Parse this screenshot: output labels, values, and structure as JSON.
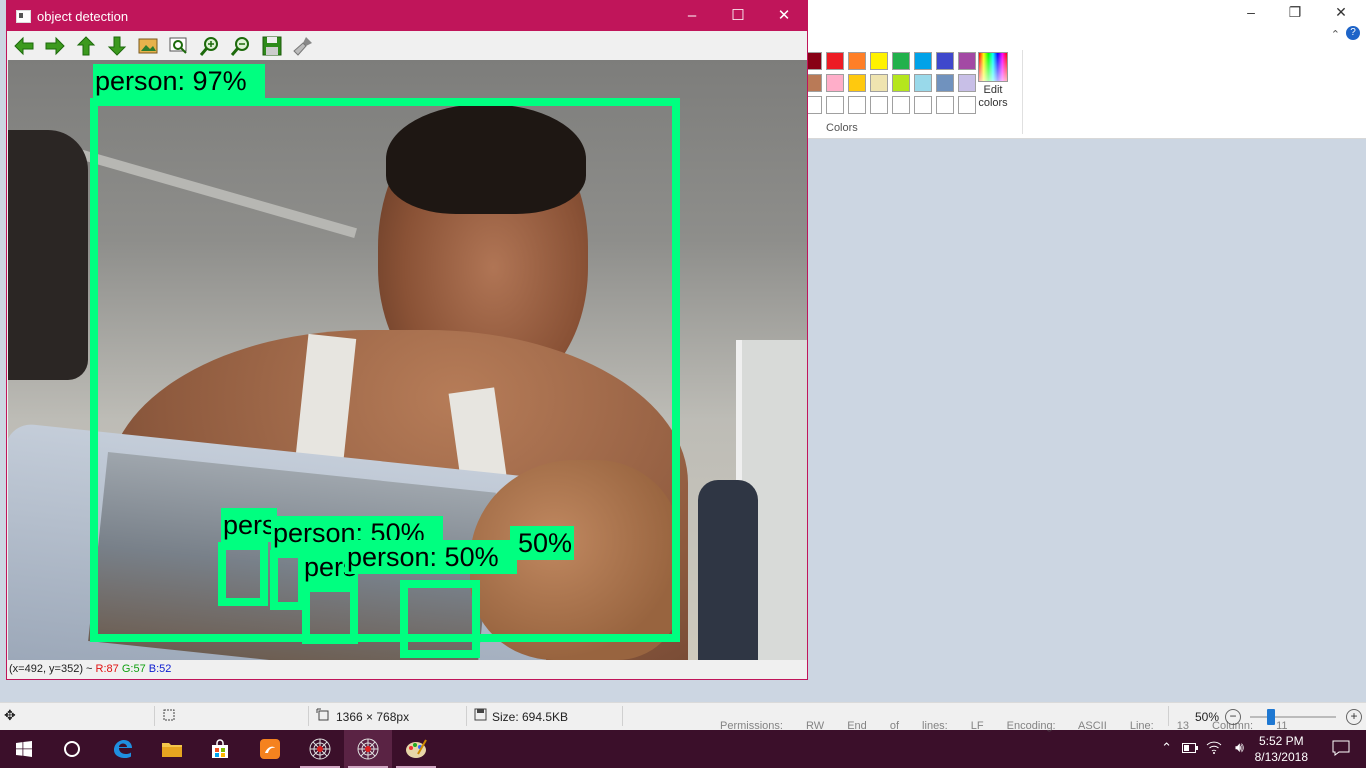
{
  "paint": {
    "ribbon": {
      "colors_label": "Colors",
      "edit_colors_label": "Edit colors"
    },
    "palette": [
      [
        "#880015",
        "#ed1c24",
        "#ff7f27",
        "#fff200",
        "#22b14c",
        "#00a2e8",
        "#3f48cc",
        "#a349a4"
      ],
      [
        "#b97a57",
        "#ffaec9",
        "#ffc90e",
        "#efe4b0",
        "#b5e61d",
        "#99d9ea",
        "#7092be",
        "#c8bfe7"
      ],
      [
        "#ffffff",
        "#ffffff",
        "#ffffff",
        "#ffffff",
        "#ffffff",
        "#ffffff",
        "#ffffff",
        "#ffffff"
      ]
    ],
    "status": {
      "dimensions": "1366 × 768px",
      "size": "Size: 694.5KB",
      "zoom": "50%"
    }
  },
  "background_text": "Permissions: RW End of lines: LF Encoding: ASCII Line: 13 Column: 11",
  "window": {
    "title": "object detection",
    "toolbar": [
      "back-arrow",
      "forward-arrow",
      "up-arrow",
      "down-arrow",
      "image",
      "zoom-fit",
      "zoom-in",
      "zoom-out",
      "save",
      "clear"
    ],
    "status": {
      "coords": "(x=492, y=352) ~",
      "r": "R:87",
      "g": "G:57",
      "b": "B:52"
    },
    "colors": {
      "title_bar": "#c0155a",
      "box": "#00ff80"
    }
  },
  "detections": [
    {
      "label": "person: 97%"
    },
    {
      "label": "person: 50%"
    },
    {
      "label": "person: 50%"
    },
    {
      "label": "person: 50%"
    },
    {
      "label": "person: 50%"
    },
    {
      "label": "person: 50%"
    }
  ],
  "taskbar": {
    "apps": [
      "start",
      "cortana",
      "edge",
      "file-explorer",
      "store",
      "uc-browser",
      "spider-app",
      "spider-app-active",
      "paint"
    ],
    "time": "5:52 PM",
    "date": "8/13/2018"
  }
}
